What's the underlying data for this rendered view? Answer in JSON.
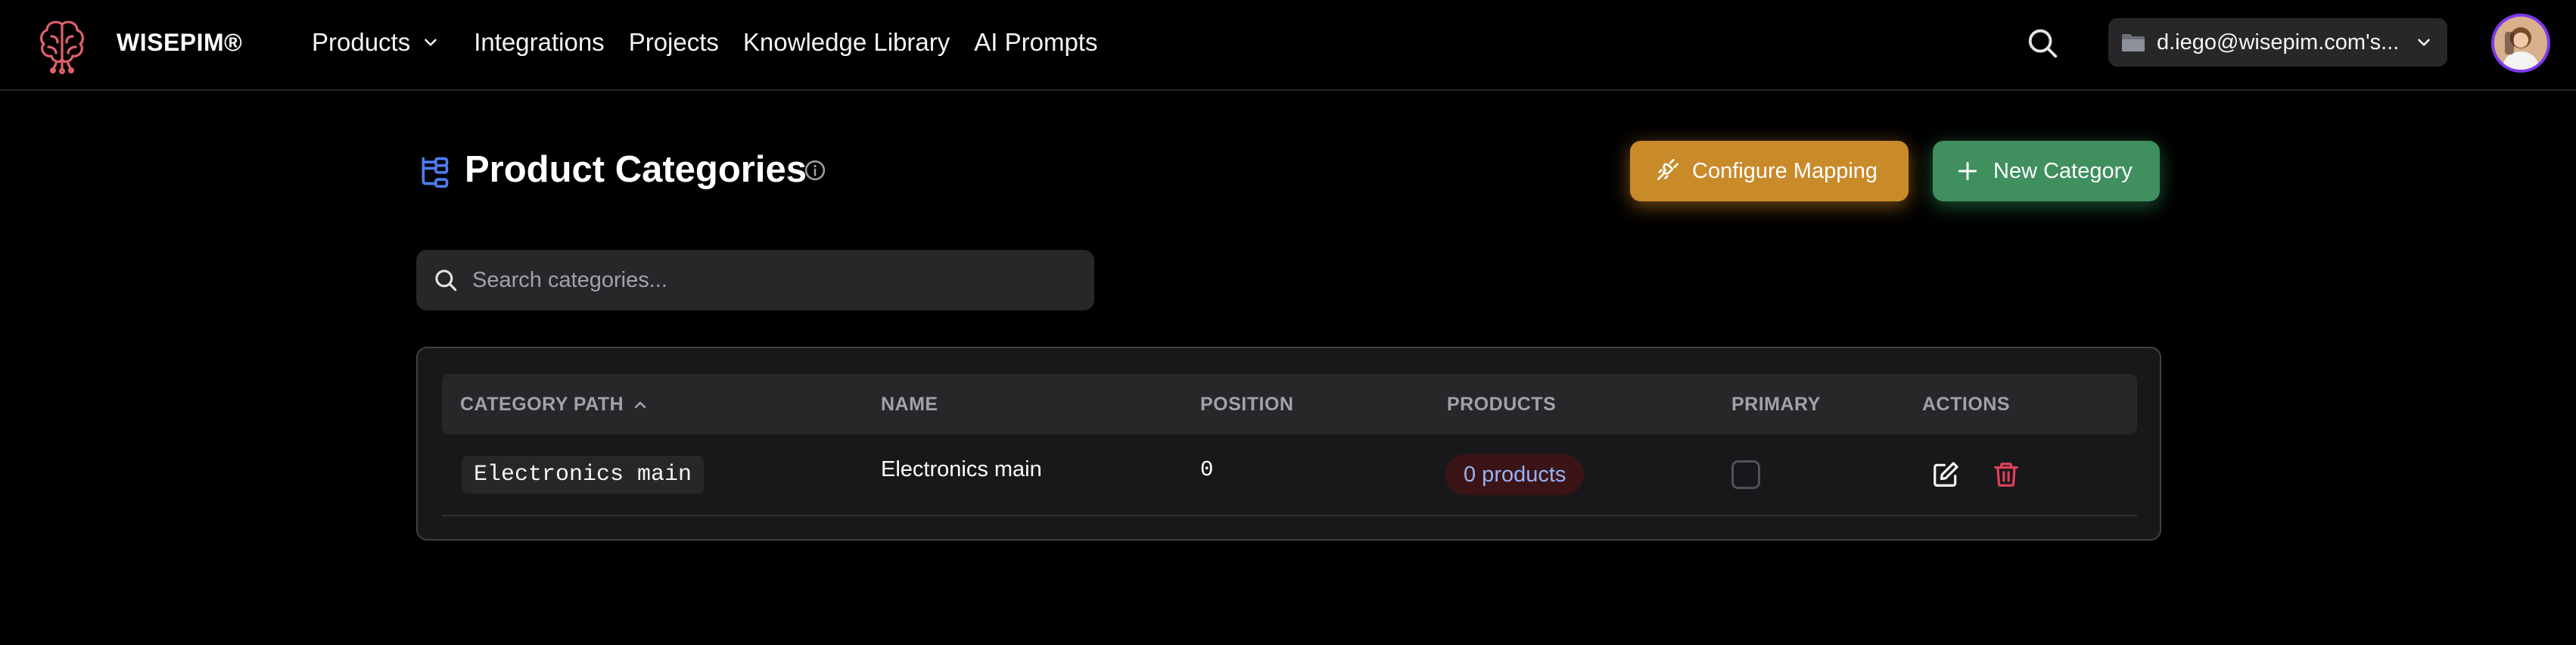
{
  "app": {
    "brand": "WISEPIM®"
  },
  "nav": {
    "items": [
      {
        "label": "Products",
        "has_dropdown": true
      },
      {
        "label": "Integrations"
      },
      {
        "label": "Projects"
      },
      {
        "label": "Knowledge Library"
      },
      {
        "label": "AI Prompts"
      }
    ]
  },
  "header": {
    "account_label": "d.iego@wisepim.com's...",
    "icons": [
      "brain-logo-icon",
      "search-icon",
      "folder-icon",
      "chevron-down-icon",
      "avatar"
    ]
  },
  "page": {
    "title": "Product Categories",
    "configure_label": "Configure Mapping",
    "new_label": "New Category"
  },
  "search": {
    "placeholder": "Search categories..."
  },
  "table": {
    "columns": [
      "CATEGORY PATH",
      "NAME",
      "POSITION",
      "PRODUCTS",
      "PRIMARY",
      "ACTIONS"
    ],
    "sort": {
      "column": "CATEGORY PATH",
      "direction": "ascending"
    },
    "rows": [
      {
        "path": "Electronics main",
        "name": "Electronics main",
        "position": "0",
        "products": "0 products",
        "primary": false
      }
    ]
  },
  "colors": {
    "background": "#000000",
    "configure_button": "#c98a2a",
    "new_button": "#3f8f5f",
    "logo": "#e0606e",
    "title_icon": "#4f7cf0",
    "delete_icon": "#e0405a",
    "products_pill_text": "#93b4f5"
  }
}
